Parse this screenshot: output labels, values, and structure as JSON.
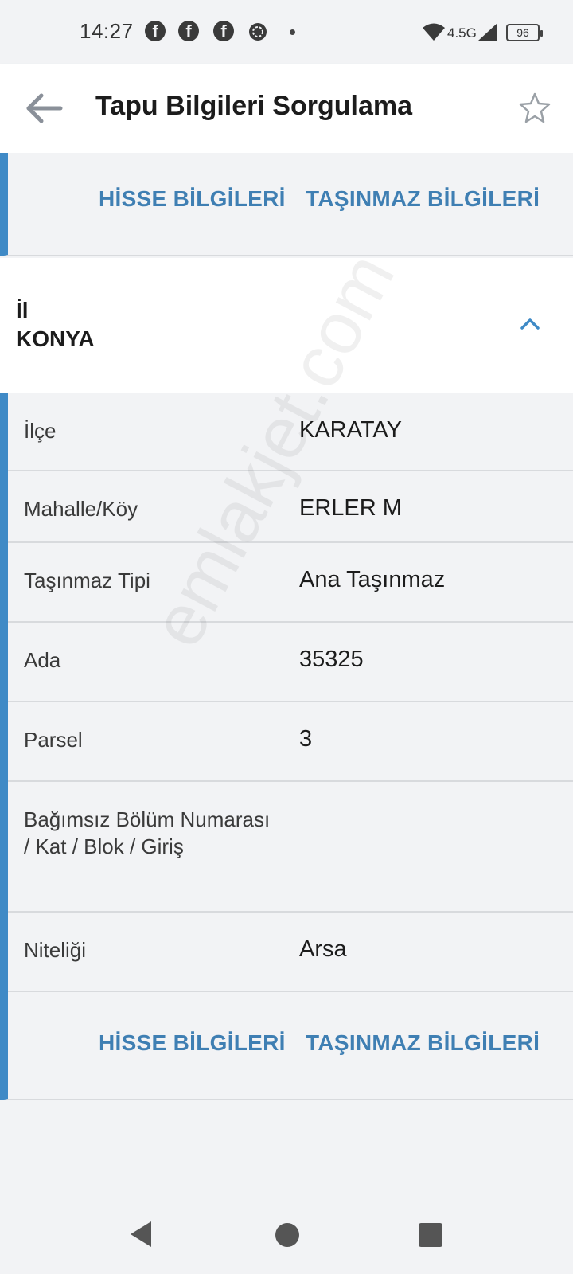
{
  "status_bar": {
    "time": "14:27",
    "network": "4.5G",
    "battery": "96",
    "notification_icons": [
      "facebook-icon",
      "facebook-icon",
      "facebook-icon",
      "chat-bubble-icon"
    ]
  },
  "app_bar": {
    "title": "Tapu Bilgileri Sorgulama"
  },
  "actions_top": {
    "shares_label": "HİSSE BİLGİLERİ",
    "property_label": "TAŞINMAZ BİLGİLERİ"
  },
  "il_section": {
    "label": "İl",
    "value": "KONYA"
  },
  "details": [
    {
      "label": "İlçe",
      "value": "KARATAY"
    },
    {
      "label": "Mahalle/Köy",
      "value": "ERLER M"
    },
    {
      "label": "Taşınmaz Tipi",
      "value": "Ana Taşınmaz"
    },
    {
      "label": "Ada",
      "value": "35325"
    },
    {
      "label": "Parsel",
      "value": "3"
    },
    {
      "label": "Bağımsız Bölüm Numarası / Kat / Blok / Giriş",
      "value": ""
    },
    {
      "label": "Niteliği",
      "value": "Arsa"
    }
  ],
  "actions_bottom": {
    "shares_label": "HİSSE BİLGİLERİ",
    "property_label": "TAŞINMAZ BİLGİLERİ"
  },
  "watermark": "emlakjet.com",
  "colors": {
    "accent": "#3f8ac6",
    "link": "#3f7fb3",
    "background": "#f2f3f5"
  }
}
